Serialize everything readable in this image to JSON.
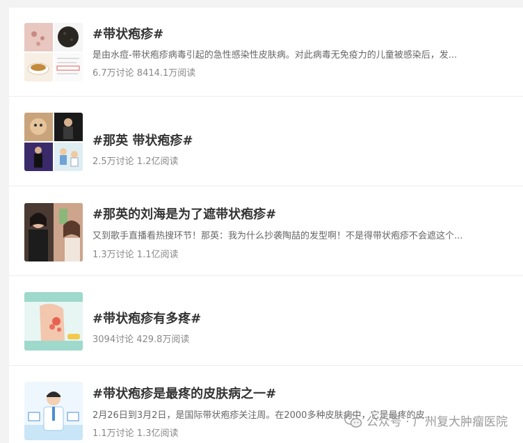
{
  "topics": [
    {
      "title": "#带状疱疹#",
      "description": "是由水痘-带状疱疹病毒引起的急性感染性皮肤病。对此病毒无免疫力的儿童被感染后，发...",
      "stats": "6.7万讨论 8414.1万阅读"
    },
    {
      "title": "#那英 带状疱疹#",
      "description": "",
      "stats": "2.5万讨论 1.2亿阅读"
    },
    {
      "title": "#那英的刘海是为了遮带状疱疹#",
      "description": "又到歌手直播看热搜环节！那英：我为什么抄袭陶喆的发型啊！不是得带状疱疹不会遮这个...",
      "stats": "1.3万讨论 1.1亿阅读"
    },
    {
      "title": "#带状疱疹有多疼#",
      "description": "",
      "stats": "3094讨论 429.8万阅读"
    },
    {
      "title": "#带状疱疹是最疼的皮肤病之一#",
      "description": "2月26日到3月2日，是国际带状疱疹关注周。在2000多种皮肤病中，它是最疼的皮...",
      "stats": "1.1万讨论 1.3亿阅读"
    }
  ],
  "watermark": {
    "text": "公众号 · 广州复大肿瘤医院",
    "icon": "wechat-icon"
  }
}
